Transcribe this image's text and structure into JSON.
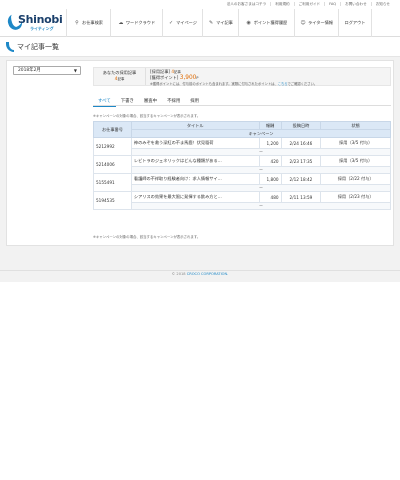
{
  "toplinks": [
    "法人のお客さまはコチラ",
    "利用規約",
    "ご利用ガイド",
    "FAQ",
    "お問い合わせ",
    "お知らせ"
  ],
  "logo": {
    "name": "Shinobi",
    "sub": "ライティング"
  },
  "nav": [
    {
      "label": "お仕事検索",
      "icon": "search-icon"
    },
    {
      "label": "ワードクラウド",
      "icon": "cloud-icon"
    },
    {
      "label": "マイページ",
      "icon": "mypage-icon"
    },
    {
      "label": "マイ記事",
      "icon": "pen-icon"
    },
    {
      "label": "ポイント獲得履歴",
      "icon": "coin-icon"
    },
    {
      "label": "ライター情報",
      "icon": "user-icon"
    },
    {
      "label": "ログアウト",
      "icon": ""
    }
  ],
  "page_title": "マイ記事一覧",
  "month_select": {
    "value": "2018年2月"
  },
  "summary": {
    "label": "あなたの採用記事",
    "count": "4",
    "count_unit": "記事",
    "adopted_label": "[採用記事]",
    "adopted_count": "4",
    "adopted_unit": "記事",
    "points_label": "[獲得ポイント]",
    "points_value": "3,900",
    "points_unit": "P",
    "note": "※獲得ポイントには、付与前のポイントも含まれます。実際に付与されたポイントは、",
    "note_link": "こちら",
    "note_tail": "でご確認ください。"
  },
  "tabs": [
    "すべて",
    "下書き",
    "審査中",
    "不採用",
    "採用"
  ],
  "caption_top": "※キャンペーンの対象の場合、該当するキャンペーンが表示されます。",
  "caption_bottom": "※キャンペーンの対象の場合、該当するキャンペーンが表示されます。",
  "table": {
    "headers": {
      "id": "お仕事番号",
      "title": "タイトル",
      "reward": "報酬",
      "date": "投稿日時",
      "status": "状態",
      "campaign": "キャンペーン"
    },
    "rows": [
      {
        "id": "5212992",
        "title": "神のみぞを救う深紅の不ま馬鹿！伏見稲荷",
        "reward": "1,200",
        "date": "2/24 16:46",
        "status": "採用（3/5 付与）",
        "campaign": "ー"
      },
      {
        "id": "5214006",
        "title": "レビトラのジェネリックはどんな種類がある…",
        "reward": "420",
        "date": "2/23 17:35",
        "status": "採用（3/5 付与）",
        "campaign": "ー"
      },
      {
        "id": "5155491",
        "title": "看護師の不祥取り経験者向け：求人情報サイ…",
        "reward": "1,800",
        "date": "2/12 18:42",
        "status": "採用（2/22 付与）",
        "campaign": "ー"
      },
      {
        "id": "5194535",
        "title": "シアリスの効果を最大限に発揮する飲み方と…",
        "reward": "480",
        "date": "2/11 13:59",
        "status": "採用（2/23 付与）",
        "campaign": "ー"
      }
    ]
  },
  "footer": {
    "prefix": "© 2018",
    "corp": "CROCO CORPORATION."
  },
  "colors": {
    "accent": "#1e88c7",
    "highlight": "#e06a00",
    "header_bg": "#dbe8f6"
  }
}
